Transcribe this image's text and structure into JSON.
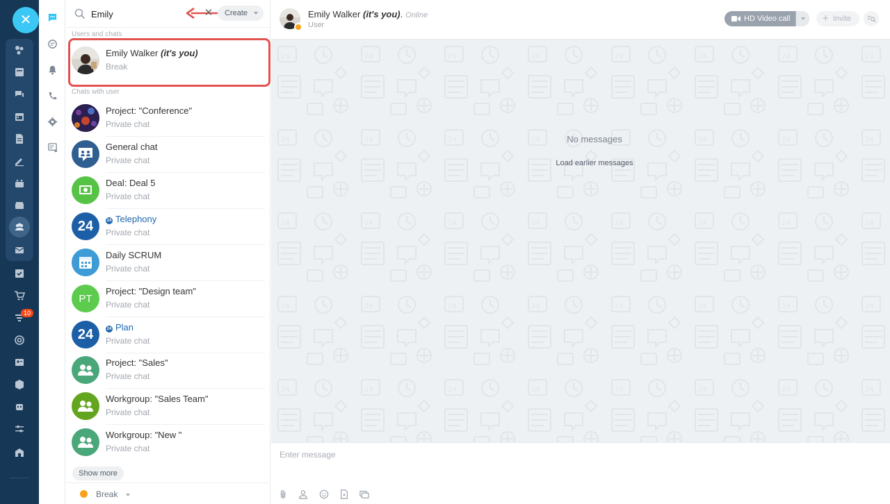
{
  "search": {
    "value": "Emily",
    "placeholder": ""
  },
  "create_button": "Create",
  "sections": {
    "users": "Users and chats",
    "chats_with_user": "Chats with user"
  },
  "user_result": {
    "name": "Emily Walker",
    "suffix": "(it's you)",
    "status": "Break"
  },
  "chats": [
    {
      "title": "Project: \"Conference\"",
      "subtitle": "Private chat",
      "avatar": "photo-conference",
      "color": "#3a2a5e"
    },
    {
      "title": "General chat",
      "subtitle": "Private chat",
      "avatar": "group-chat-icon",
      "color": "#2f5e91"
    },
    {
      "title": "Deal: Deal 5",
      "subtitle": "Private chat",
      "avatar": "deal-icon",
      "color": "#57c346"
    },
    {
      "title": "Telephony",
      "subtitle": "Private chat",
      "avatar": "24",
      "color": "#1d5fa6",
      "blue": true
    },
    {
      "title": "Daily SCRUM",
      "subtitle": "Private chat",
      "avatar": "calendar-icon",
      "color": "#3d9bd6"
    },
    {
      "title": "Project: \"Design team\"",
      "subtitle": "Private chat",
      "avatar": "PT",
      "color": "#5ccb4e"
    },
    {
      "title": "Plan",
      "subtitle": "Private chat",
      "avatar": "24",
      "color": "#1d5fa6",
      "blue": true
    },
    {
      "title": "Project: \"Sales\"",
      "subtitle": "Private chat",
      "avatar": "group-icon",
      "color": "#4aa77a"
    },
    {
      "title": "Workgroup: \"Sales Team\"",
      "subtitle": "Private chat",
      "avatar": "group-icon",
      "color": "#64a51f"
    },
    {
      "title": "Workgroup: \"New \"",
      "subtitle": "Private chat",
      "avatar": "group-icon",
      "color": "#4aa77a"
    }
  ],
  "show_more": "Show more",
  "my_status": "Break",
  "header": {
    "name": "Emily Walker",
    "suffix": "(it's you)",
    "separator": ".",
    "online": "Online",
    "role": "User"
  },
  "video_call": "HD Video call",
  "invite": "Invite",
  "chat_body": {
    "empty": "No messages",
    "load_earlier": "Load earlier messages"
  },
  "composer": {
    "placeholder": "Enter message"
  },
  "badges": {
    "rail_count": "10"
  },
  "colors": {
    "accent": "#3bc8f5",
    "highlight": "#e2524f",
    "rail": "#163755",
    "status_break": "#f8a21a"
  }
}
